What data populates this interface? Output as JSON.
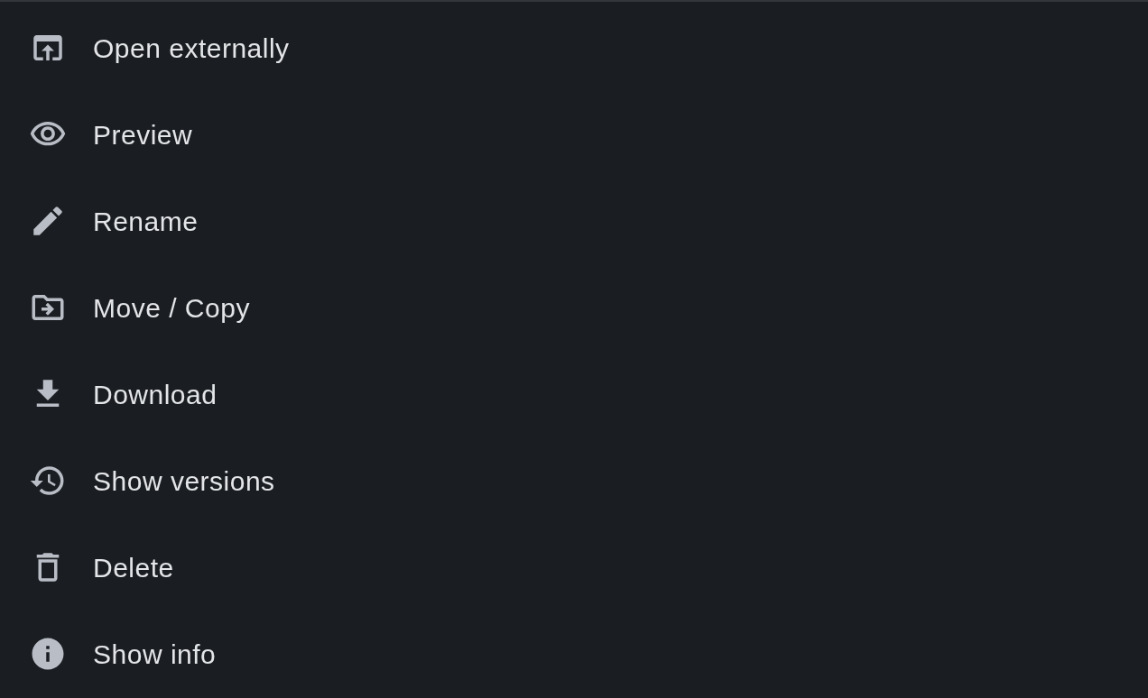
{
  "menu": {
    "items": [
      {
        "kind": "external",
        "label": "Open externally"
      },
      {
        "kind": "eye",
        "label": "Preview"
      },
      {
        "kind": "pencil",
        "label": "Rename"
      },
      {
        "kind": "move",
        "label": "Move / Copy"
      },
      {
        "kind": "download",
        "label": "Download"
      },
      {
        "kind": "history",
        "label": "Show versions"
      },
      {
        "kind": "trash",
        "label": "Delete"
      },
      {
        "kind": "info",
        "label": "Show info"
      }
    ]
  }
}
